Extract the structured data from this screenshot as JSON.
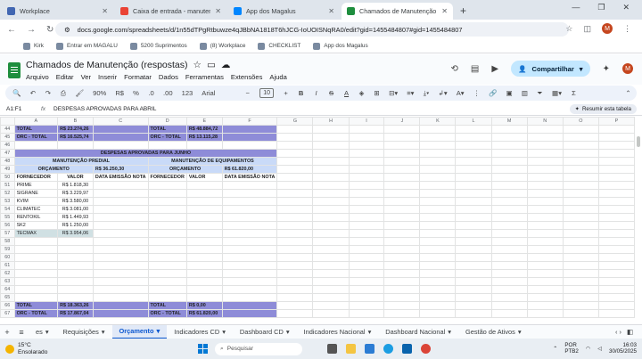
{
  "browser": {
    "tabs": [
      {
        "label": "Workplace",
        "color": "#4267b2",
        "active": false
      },
      {
        "label": "Caixa de entrada - manutencao",
        "color": "#ea4335",
        "active": false
      },
      {
        "label": "App dos Magalus",
        "color": "#0086ff",
        "active": false
      },
      {
        "label": "Chamados de Manutenção (res",
        "color": "#1e8e3e",
        "active": true
      }
    ],
    "url": "docs.google.com/spreadsheets/d/1n55dTPgRtbuwze4qJBbNA1818T6hJCG-IoUOISNqRA0/edit?gid=1455484807#gid=1455484807",
    "avatar": "M",
    "bookmarks": [
      "Kirk",
      "Entrar em MAGALU",
      "5200 Suprimentos",
      "(8) Workplace",
      "CHECKLIST",
      "App dos Magalus"
    ]
  },
  "doc": {
    "title": "Chamados de Manutenção (respostas)",
    "menus": [
      "Arquivo",
      "Editar",
      "Ver",
      "Inserir",
      "Formatar",
      "Dados",
      "Ferramentas",
      "Extensões",
      "Ajuda"
    ],
    "share_label": "Compartilhar",
    "avatar": "M"
  },
  "toolbar": {
    "zoom": "90%",
    "currency": "R$",
    "percent": "%",
    "dec1": ".0",
    "dec2": ".00",
    "numfmt": "123",
    "font": "Arial",
    "size": "10",
    "minus": "−",
    "plus": "+",
    "bold": "B",
    "italic": "I",
    "strike": "S",
    "textcolor": "A"
  },
  "formula_bar": {
    "cell": "A1:F1",
    "fx": "fx",
    "content": "DESPESAS APROVADAS PARA ABRIL",
    "summary": "Resumir esta tabela"
  },
  "columns": [
    "A",
    "B",
    "C",
    "D",
    "E",
    "F",
    "G",
    "H",
    "I",
    "J",
    "K",
    "L",
    "M",
    "N",
    "O",
    "P"
  ],
  "rows": [
    {
      "n": "44",
      "cells": [
        "TOTAL",
        "R$ 23.274,26",
        "",
        "TOTAL",
        "R$ 48.884,72",
        ""
      ],
      "style": "purple"
    },
    {
      "n": "45",
      "cells": [
        "ORC - TOTAL",
        "R$ 16.525,74",
        "",
        "ORC - TOTAL",
        "R$ 13.115,28",
        ""
      ],
      "style": "purple"
    },
    {
      "n": "46",
      "cells": [
        "",
        "",
        "",
        "",
        "",
        ""
      ]
    },
    {
      "n": "47",
      "cells": [
        "DESPESAS APROVADAS PARA JUNHO"
      ],
      "style": "purple-merged"
    },
    {
      "n": "48",
      "cells": [
        "MANUTENÇÃO PREDIAL",
        "MANUTENÇÃO DE EQUIPAMENTOS"
      ],
      "style": "blue-split"
    },
    {
      "n": "49",
      "cells": [
        "ORÇAMENTO",
        "R$ 36.250,30",
        "ORÇAMENTO",
        "R$ 61.820,00"
      ],
      "style": "blue-orc"
    },
    {
      "n": "50",
      "cells": [
        "FORNECEDOR",
        "VALOR",
        "DATA EMISSÃO NOTA",
        "FORNECEDOR",
        "VALOR",
        "DATA EMISSÃO NOTA"
      ]
    },
    {
      "n": "51",
      "cells": [
        "PRIME",
        "R$ 1.818,30",
        "",
        "",
        "",
        ""
      ]
    },
    {
      "n": "52",
      "cells": [
        "SIGRANE",
        "R$ 3.229,97",
        "",
        "",
        "",
        ""
      ]
    },
    {
      "n": "53",
      "cells": [
        "KVIM",
        "R$ 3.580,00",
        "",
        "",
        "",
        ""
      ]
    },
    {
      "n": "54",
      "cells": [
        "CLIMATEC",
        "R$ 3.081,00",
        "",
        "",
        "",
        ""
      ]
    },
    {
      "n": "55",
      "cells": [
        "RENTOKIL",
        "R$ 1.449,93",
        "",
        "",
        "",
        ""
      ]
    },
    {
      "n": "56",
      "cells": [
        "SK2",
        "R$ 1.250,00",
        "",
        "",
        "",
        ""
      ]
    },
    {
      "n": "57",
      "cells": [
        "TECMAX",
        "R$ 3.954,06",
        "",
        "",
        "",
        ""
      ],
      "style": "tecmax"
    },
    {
      "n": "58",
      "cells": [
        "",
        "",
        "",
        "",
        "",
        ""
      ]
    },
    {
      "n": "59",
      "cells": [
        "",
        "",
        "",
        "",
        "",
        ""
      ]
    },
    {
      "n": "60",
      "cells": [
        "",
        "",
        "",
        "",
        "",
        ""
      ]
    },
    {
      "n": "61",
      "cells": [
        "",
        "",
        "",
        "",
        "",
        ""
      ]
    },
    {
      "n": "62",
      "cells": [
        "",
        "",
        "",
        "",
        "",
        ""
      ]
    },
    {
      "n": "63",
      "cells": [
        "",
        "",
        "",
        "",
        "",
        ""
      ]
    },
    {
      "n": "64",
      "cells": [
        "",
        "",
        "",
        "",
        "",
        ""
      ]
    },
    {
      "n": "65",
      "cells": [
        "",
        "",
        "",
        "",
        "",
        ""
      ]
    },
    {
      "n": "66",
      "cells": [
        "TOTAL",
        "R$ 18.363,26",
        "",
        "TOTAL",
        "R$ 0,00",
        ""
      ],
      "style": "purple"
    },
    {
      "n": "67",
      "cells": [
        "ORC - TOTAL",
        "R$ 17.867,04",
        "",
        "ORC - TOTAL",
        "R$ 61.820,00",
        ""
      ],
      "style": "purple"
    }
  ],
  "sheet_tabs": [
    "es",
    "Requisições",
    "Orçamento",
    "Indicadores CD",
    "Dashboard CD",
    "Indicadores Nacional",
    "Dashboard Nacional",
    "Gestão de Ativos"
  ],
  "active_sheet": "Orçamento",
  "taskbar": {
    "temp": "15°C",
    "weather": "Ensolarado",
    "search": "Pesquisar",
    "lang1": "POR",
    "lang2": "PTB2",
    "time": "16:03",
    "date": "30/05/2025",
    "badge": "3"
  }
}
